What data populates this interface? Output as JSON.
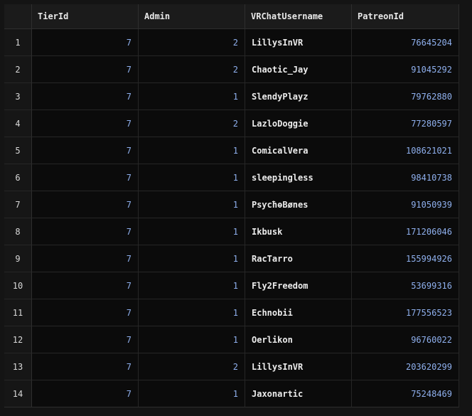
{
  "table": {
    "columns": [
      "TierId",
      "Admin",
      "VRChatUsername",
      "PatreonId"
    ],
    "rows": [
      {
        "index": "1",
        "tier_id": "7",
        "admin": "2",
        "username": "LillysInVR",
        "patreon_id": "76645204"
      },
      {
        "index": "2",
        "tier_id": "7",
        "admin": "2",
        "username": "Chaotic_Jay",
        "patreon_id": "91045292"
      },
      {
        "index": "3",
        "tier_id": "7",
        "admin": "1",
        "username": "SlendyPlayz",
        "patreon_id": "79762880"
      },
      {
        "index": "4",
        "tier_id": "7",
        "admin": "2",
        "username": "LazloDoggie",
        "patreon_id": "77280597"
      },
      {
        "index": "5",
        "tier_id": "7",
        "admin": "1",
        "username": "ComicalVera",
        "patreon_id": "108621021"
      },
      {
        "index": "6",
        "tier_id": "7",
        "admin": "1",
        "username": "sleepingless",
        "patreon_id": "98410738"
      },
      {
        "index": "7",
        "tier_id": "7",
        "admin": "1",
        "username": "PsƴcħѳBønes",
        "patreon_id": "91050939"
      },
      {
        "index": "8",
        "tier_id": "7",
        "admin": "1",
        "username": "Ikbusk",
        "patreon_id": "171206046"
      },
      {
        "index": "9",
        "tier_id": "7",
        "admin": "1",
        "username": "RacTarro",
        "patreon_id": "155994926"
      },
      {
        "index": "10",
        "tier_id": "7",
        "admin": "1",
        "username": "Fly2Freedom",
        "patreon_id": "53699316"
      },
      {
        "index": "11",
        "tier_id": "7",
        "admin": "1",
        "username": "Echnobii",
        "patreon_id": "177556523"
      },
      {
        "index": "12",
        "tier_id": "7",
        "admin": "1",
        "username": "Oerlikon",
        "patreon_id": "96760022"
      },
      {
        "index": "13",
        "tier_id": "7",
        "admin": "2",
        "username": "LillysInVR",
        "patreon_id": "203620299"
      },
      {
        "index": "14",
        "tier_id": "7",
        "admin": "1",
        "username": "Jaxonartic",
        "patreon_id": "75248469"
      }
    ]
  },
  "colors": {
    "background": "#141414",
    "header_background": "#1b1b1b",
    "numeric_text": "#8fb0ee",
    "text": "#ececec"
  }
}
